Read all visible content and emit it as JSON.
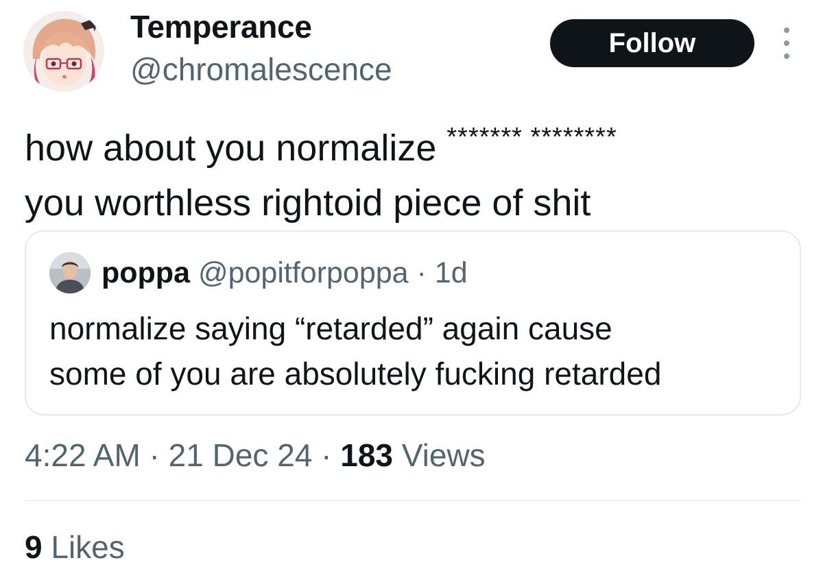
{
  "author": {
    "display_name": "Temperance",
    "handle": "@chromalescence",
    "avatar_icon": "anime-avatar-icon"
  },
  "actions": {
    "follow_label": "Follow",
    "more_icon": "more-vertical-icon"
  },
  "tweet": {
    "line1": "how about you normalize",
    "censored": "******* ********",
    "line2": "you worthless rightoid piece of shit"
  },
  "quoted": {
    "name": "poppa",
    "handle": "@popitforpoppa",
    "separator": "·",
    "time": "1d",
    "line1": "normalize saying “retarded” again cause",
    "line2": "some of you are absolutely fucking retarded",
    "avatar_icon": "profile-photo-icon"
  },
  "meta": {
    "time": "4:22 AM",
    "separator": "·",
    "date": "21 Dec 24",
    "views_count": "183",
    "views_label": "Views"
  },
  "engagement": {
    "likes_count": "9",
    "likes_label": "Likes"
  },
  "colors": {
    "text_primary": "#0f1419",
    "text_secondary": "#536471",
    "border": "#e7e9ea",
    "button_bg": "#0f1419"
  }
}
